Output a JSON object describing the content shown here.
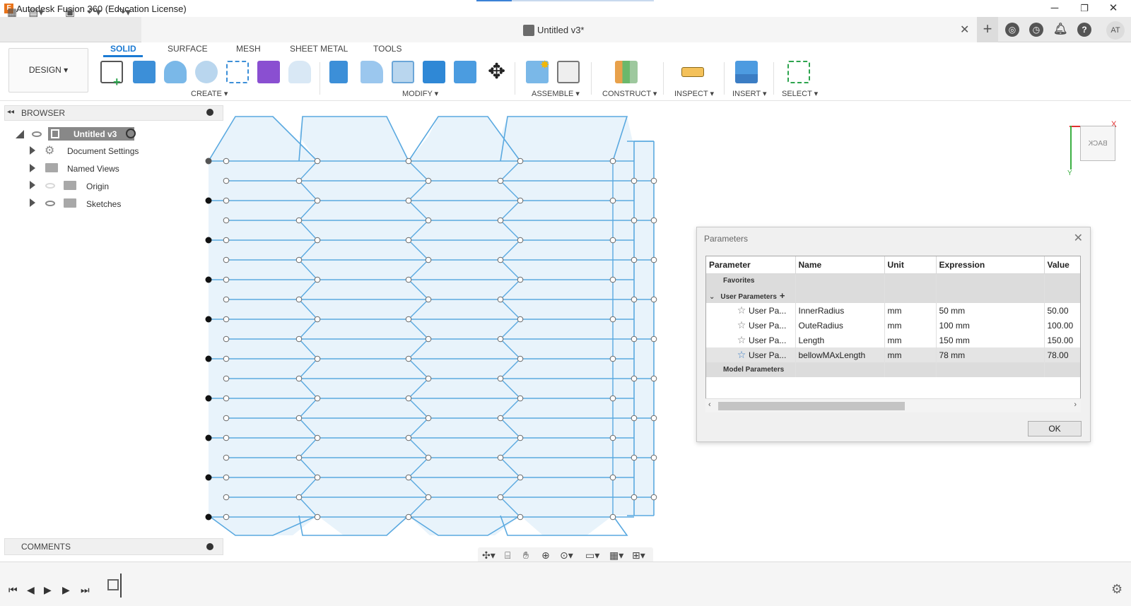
{
  "window": {
    "title": "Autodesk Fusion 360 (Education License)",
    "logo_letter": "F",
    "minimize": "─",
    "restore": "❐",
    "close": "✕",
    "progress": 0.2
  },
  "document_tab": {
    "label": "Untitled v3*",
    "close": "✕",
    "add": "+"
  },
  "user": {
    "initials": "AT"
  },
  "ribbon": {
    "workspace": "DESIGN ▾",
    "tabs": [
      "SOLID",
      "SURFACE",
      "MESH",
      "SHEET METAL",
      "TOOLS"
    ],
    "active_tab": "SOLID",
    "groups": {
      "create": "CREATE ▾",
      "modify": "MODIFY ▾",
      "assemble": "ASSEMBLE ▾",
      "construct": "CONSTRUCT ▾",
      "inspect": "INSPECT ▾",
      "insert": "INSERT ▾",
      "select": "SELECT ▾"
    }
  },
  "browser": {
    "title": "BROWSER",
    "root": "Untitled v3",
    "items": [
      "Document Settings",
      "Named Views",
      "Origin",
      "Sketches"
    ]
  },
  "comments": {
    "label": "COMMENTS"
  },
  "viewcube": {
    "face": "BACK",
    "axis_x": "X",
    "axis_y": "Y"
  },
  "parameters_dialog": {
    "title": "Parameters",
    "columns": [
      "Parameter",
      "Name",
      "Unit",
      "Expression",
      "Value"
    ],
    "favorites_label": "Favorites",
    "user_params_label": "User Parameters",
    "model_params_label": "Model Parameters",
    "rows": [
      {
        "parameter": "User Pa...",
        "name": "InnerRadius",
        "unit": "mm",
        "expression": "50 mm",
        "value": "50.00"
      },
      {
        "parameter": "User Pa...",
        "name": "OuteRadius",
        "unit": "mm",
        "expression": "100 mm",
        "value": "100.00"
      },
      {
        "parameter": "User Pa...",
        "name": "Length",
        "unit": "mm",
        "expression": "150 mm",
        "value": "150.00"
      },
      {
        "parameter": "User Pa...",
        "name": "bellowMAxLength",
        "unit": "mm",
        "expression": "78 mm",
        "value": "78.00"
      }
    ],
    "ok_label": "OK"
  },
  "colors": {
    "sketch_line": "#5aa9e0",
    "sketch_fill": "#e8f3fb",
    "accent": "#1b7ad3"
  }
}
